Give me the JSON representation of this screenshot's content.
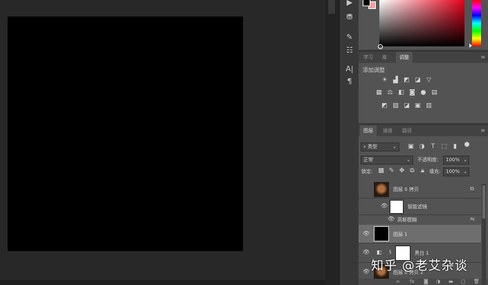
{
  "colors": {
    "foreground": "#000000",
    "background": "#f0a0a0",
    "accent": "#e8001a"
  },
  "dock": {
    "icons": [
      "play-icon",
      "layers-comps-icon",
      "brush-icon",
      "sliders-icon",
      "character-icon",
      "paragraph-icon"
    ]
  },
  "adjust_panel": {
    "tabs": [
      "学习",
      "库",
      "调整"
    ],
    "active_tab": "调整",
    "title": "添加调整",
    "icons": [
      "brightness-icon",
      "levels-icon",
      "curves-icon",
      "exposure-icon",
      "vibrance-icon",
      "hue-sat-icon",
      "color-balance-icon",
      "bw-icon",
      "photo-filter-icon",
      "channel-mixer-icon",
      "color-lookup-icon",
      "invert-icon",
      "posterize-icon",
      "threshold-icon",
      "selective-color-icon",
      "gradient-map-icon"
    ]
  },
  "layers_panel": {
    "tabs": [
      "图层",
      "通道",
      "路径"
    ],
    "active_tab": "图层",
    "filter": "类型",
    "blend_mode": "正常",
    "opacity_label": "不透明度:",
    "opacity": "100%",
    "lock_label": "锁定:",
    "fill_label": "填充:",
    "fill": "100%",
    "layers": [
      {
        "name": "图层 0 拷贝",
        "visible": false,
        "selected": false,
        "thumb": "portrait"
      },
      {
        "name": "智能滤镜",
        "visible": true,
        "selected": false,
        "thumb": "white",
        "indent": true
      },
      {
        "name": "高斯模糊",
        "visible": true,
        "selected": false,
        "sub": true
      },
      {
        "name": "图层 1",
        "visible": true,
        "selected": true,
        "thumb": "black"
      },
      {
        "name": "黑白 1",
        "visible": true,
        "selected": false,
        "thumb": "white",
        "adjust": true
      },
      {
        "name": "图层 0 拷贝 2",
        "visible": true,
        "selected": false,
        "thumb": "portrait"
      }
    ]
  },
  "watermark": "知乎 @老艾杂谈"
}
